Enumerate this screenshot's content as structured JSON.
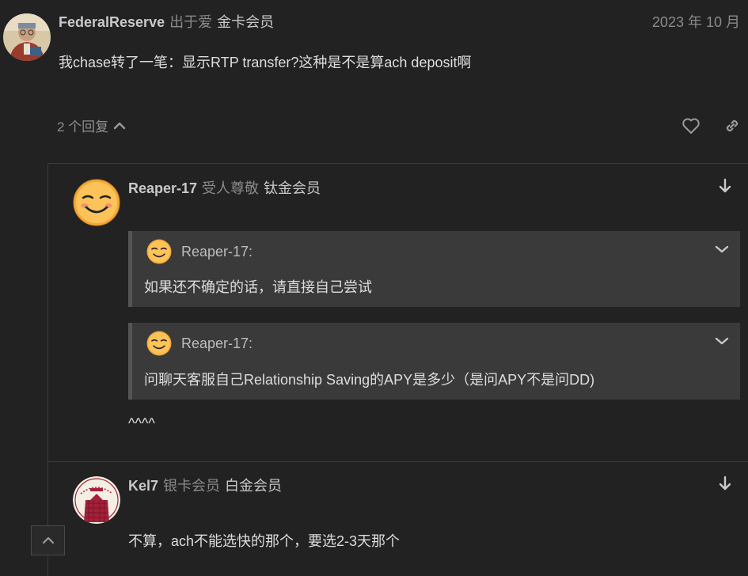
{
  "post1": {
    "username": "FederalReserve",
    "title_flair": "出于爱",
    "group_flair": "金卡会员",
    "date": "2023 年 10 月",
    "text": "我chase转了一笔：显示RTP transfer?这种是不是算ach deposit啊",
    "replies_label": "2 个回复"
  },
  "reply1": {
    "username": "Reaper-17",
    "title_flair": "受人尊敬",
    "group_flair": "钛金会员",
    "quotes": [
      {
        "author": "Reaper-17:",
        "text": "如果还不确定的话，请直接自己尝试"
      },
      {
        "author": "Reaper-17:",
        "text": "问聊天客服自己Relationship Saving的APY是多少（是问APY不是问DD)"
      }
    ],
    "text": "^^^^"
  },
  "reply2": {
    "username": "Kel7",
    "title_flair": "银卡会员",
    "group_flair": "白金会员",
    "text": "不算，ach不能选快的那个，要选2-3天那个"
  },
  "colors": {
    "background": "#222222",
    "quote_background": "#3a3a3a",
    "quote_border": "#555555",
    "muted_text": "#8a8a8a"
  },
  "icons": {
    "like": "heart-icon",
    "share": "link-icon",
    "jump": "arrow-down-icon",
    "expand": "chevron-down-icon",
    "collapse": "chevron-up-icon"
  }
}
